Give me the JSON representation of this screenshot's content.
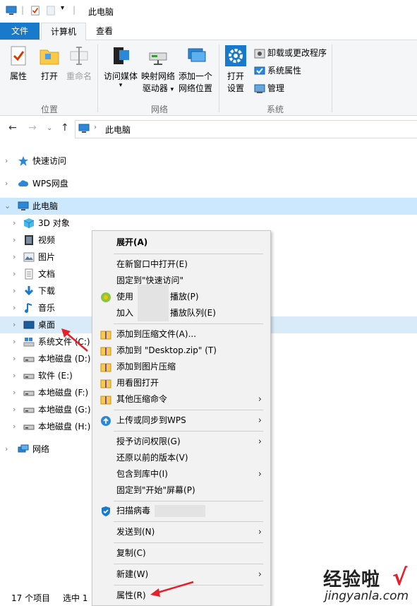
{
  "window": {
    "title": "此电脑"
  },
  "quick_access_toolbar": {
    "icons": [
      "computer-icon",
      "properties-check-icon",
      "new-folder-icon",
      "dropdown-arrow-icon"
    ]
  },
  "ribbon": {
    "tabs": [
      {
        "label": "文件",
        "active": false,
        "accent": "#1979ca"
      },
      {
        "label": "计算机",
        "active": true
      },
      {
        "label": "查看",
        "active": false
      }
    ],
    "groups": [
      {
        "label": "位置",
        "buttons": [
          {
            "label": "属性",
            "icon": "properties-icon"
          },
          {
            "label": "打开",
            "icon": "open-folder-icon"
          },
          {
            "label": "重命名",
            "icon": "rename-icon",
            "disabled": true
          }
        ]
      },
      {
        "label": "网络",
        "buttons": [
          {
            "label": "访问媒体",
            "icon": "media-icon"
          },
          {
            "label_line1": "映射网络",
            "label_line2": "驱动器",
            "icon": "map-drive-icon"
          },
          {
            "label_line1": "添加一个",
            "label_line2": "网络位置",
            "icon": "network-location-icon"
          }
        ]
      },
      {
        "label": "系统",
        "buttons": [
          {
            "label_line1": "打开",
            "label_line2": "设置",
            "icon": "settings-gear-icon"
          }
        ],
        "small_buttons": [
          {
            "label": "卸载或更改程序",
            "icon": "uninstall-icon"
          },
          {
            "label": "系统属性",
            "icon": "system-properties-icon"
          },
          {
            "label": "管理",
            "icon": "manage-icon"
          }
        ]
      }
    ]
  },
  "address_bar": {
    "path": "此电脑"
  },
  "nav_tree": {
    "top": [
      {
        "label": "快速访问",
        "icon": "star-icon"
      },
      {
        "label": "WPS网盘",
        "icon": "cloud-icon"
      },
      {
        "label": "此电脑",
        "icon": "computer-icon",
        "selected": true
      }
    ],
    "children": [
      {
        "label": "3D 对象",
        "icon": "cube-icon"
      },
      {
        "label": "视频",
        "icon": "video-icon"
      },
      {
        "label": "图片",
        "icon": "picture-icon"
      },
      {
        "label": "文档",
        "icon": "document-icon"
      },
      {
        "label": "下载",
        "icon": "download-icon"
      },
      {
        "label": "音乐",
        "icon": "music-icon"
      },
      {
        "label": "桌面",
        "icon": "desktop-icon",
        "highlighted": true
      },
      {
        "label": "系统文件 (C:)",
        "icon": "windows-drive-icon"
      },
      {
        "label": "本地磁盘 (D:)",
        "icon": "drive-icon"
      },
      {
        "label": "软件 (E:)",
        "icon": "drive-icon"
      },
      {
        "label": "本地磁盘 (F:)",
        "icon": "drive-icon"
      },
      {
        "label": "本地磁盘 (G:)",
        "icon": "drive-icon"
      },
      {
        "label": "本地磁盘 (H:)",
        "icon": "drive-icon"
      }
    ],
    "network": {
      "label": "网络",
      "icon": "network-icon"
    }
  },
  "status_bar": {
    "item_count": "17 个项目",
    "selection": "选中 1"
  },
  "context_menu": {
    "items": [
      {
        "label": "展开(A)",
        "bold": true
      },
      {
        "label": "在新窗口中打开(E)"
      },
      {
        "label": "固定到\"快速访问\""
      },
      {
        "label": "使用",
        "suffix": "播放(P)",
        "icon": "player-icon",
        "redacted": true
      },
      {
        "label": "加入",
        "suffix": "播放队列(E)",
        "redacted": true
      },
      {
        "label": "添加到压缩文件(A)...",
        "icon": "archive-icon"
      },
      {
        "label": "添加到 \"Desktop.zip\" (T)",
        "icon": "archive-icon"
      },
      {
        "label": "添加到图片压缩",
        "icon": "archive-icon"
      },
      {
        "label": "用看图打开",
        "icon": "archive-icon"
      },
      {
        "label": "其他压缩命令",
        "icon": "archive-icon",
        "submenu": true
      },
      {
        "label": "上传或同步到WPS",
        "icon": "cloud-upload-icon",
        "submenu": true
      },
      {
        "label": "授予访问权限(G)",
        "submenu": true
      },
      {
        "label": "还原以前的版本(V)"
      },
      {
        "label": "包含到库中(I)",
        "submenu": true
      },
      {
        "label": "固定到\"开始\"屏幕(P)"
      },
      {
        "label": "扫描病毒",
        "icon": "shield-icon",
        "redacted": true
      },
      {
        "label": "发送到(N)",
        "submenu": true
      },
      {
        "label": "复制(C)"
      },
      {
        "label": "新建(W)",
        "submenu": true
      },
      {
        "label": "属性(R)"
      }
    ]
  },
  "watermark": {
    "text": "经验啦",
    "check": "√",
    "url": "jingyanla.com"
  },
  "colors": {
    "accent": "#1979ca",
    "selection": "#cce8ff",
    "annotation_arrow": "#e6202a"
  }
}
